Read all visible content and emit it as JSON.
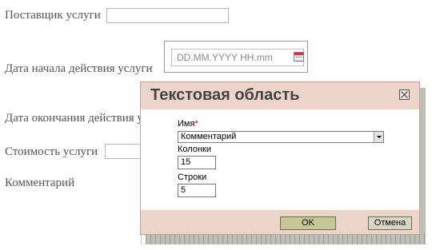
{
  "form": {
    "provider_label": "Поставщик услуги",
    "start_date_label": "Дата начала действия услуги",
    "start_date_placeholder": "DD.MM.YYYY HH.mm",
    "end_date_label": "Дата окончания действия услуги",
    "price_label": "Стоимость услуги",
    "comment_label": "Комментарий"
  },
  "dialog": {
    "title": "Текстовая область",
    "name_label": "Имя",
    "required_mark": "*",
    "name_value": "Комментарий",
    "columns_label": "Колонки",
    "columns_value": "15",
    "rows_label": "Строки",
    "rows_value": "5",
    "ok_label": "OK",
    "cancel_label": "Отмена"
  },
  "colors": {
    "dialog_header": "#ecd5c8",
    "ok_button": "#c6c796",
    "required": "#d00000"
  }
}
